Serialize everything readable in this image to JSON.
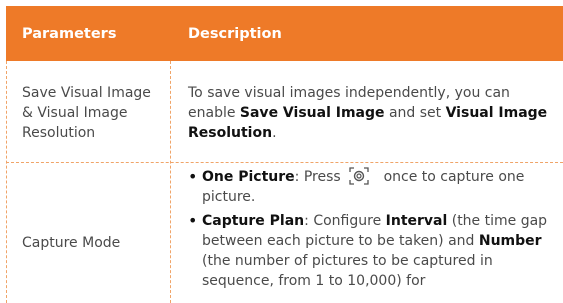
{
  "header": {
    "col1": "Parameters",
    "col2": "Description"
  },
  "rows": [
    {
      "param": "Save Visual Image & Visual Image Resolution",
      "desc_parts": [
        "To save visual images independently, you can enable ",
        "Save Visual Image",
        " and set ",
        "Visual Image Resolution",
        "."
      ]
    },
    {
      "param": "Capture Mode",
      "bullets": [
        {
          "parts": [
            "One Picture",
            ": Press ",
            " once to capture one picture."
          ],
          "icon": "capture-button-icon"
        },
        {
          "parts": [
            "Capture Plan",
            ": Configure ",
            "Interval",
            " (the time gap between each picture to be taken) and ",
            "Number",
            " (the number of pictures to be captured in sequence, from 1 to 10,000) for"
          ]
        }
      ]
    }
  ]
}
